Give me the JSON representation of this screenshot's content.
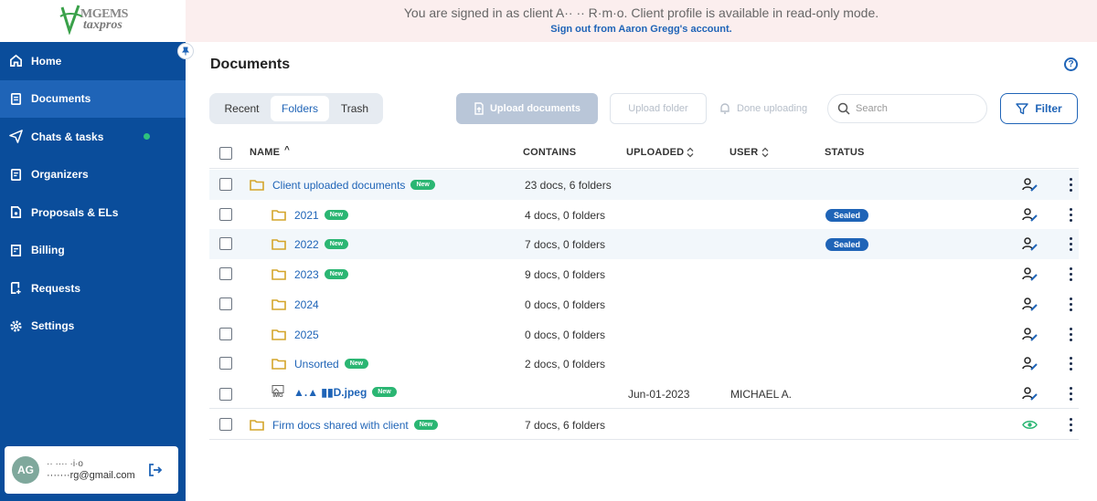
{
  "logo": {
    "line1": "MGEMS",
    "line2": "taxpros"
  },
  "banner": {
    "line1": "You are signed in as client A·· ·· R·m·o. Client profile is available in read-only mode.",
    "line2": "Sign out from Aaron Gregg's account."
  },
  "sidebar": {
    "items": [
      {
        "label": "Home",
        "icon": "home-icon"
      },
      {
        "label": "Documents",
        "icon": "document-icon"
      },
      {
        "label": "Chats & tasks",
        "icon": "send-icon"
      },
      {
        "label": "Organizers",
        "icon": "clipboard-icon"
      },
      {
        "label": "Proposals & ELs",
        "icon": "file-icon"
      },
      {
        "label": "Billing",
        "icon": "invoice-icon"
      },
      {
        "label": "Requests",
        "icon": "request-icon"
      },
      {
        "label": "Settings",
        "icon": "gear-icon"
      }
    ]
  },
  "user": {
    "initials": "AG",
    "name": "·· ···· ·i·o",
    "email": "·······rg@gmail.com"
  },
  "page": {
    "title": "Documents"
  },
  "tabs": [
    "Recent",
    "Folders",
    "Trash"
  ],
  "toolbar": {
    "upload": "Upload documents",
    "upload_folder": "Upload folder",
    "done": "Done uploading",
    "search_placeholder": "Search",
    "filter": "Filter"
  },
  "table": {
    "headers": {
      "name": "NAME",
      "sort": "^",
      "contains": "CONTAINS",
      "uploaded": "UPLOADED",
      "user": "USER",
      "status": "STATUS"
    },
    "new_label": "New",
    "sealed_label": "Sealed",
    "rows": [
      {
        "name": "Client uploaded documents",
        "contains": "23 docs, 6 folders",
        "uploaded": "",
        "user": "",
        "status": ""
      },
      {
        "name": "2021",
        "contains": "4 docs, 0 folders",
        "uploaded": "",
        "user": "",
        "status": "Sealed"
      },
      {
        "name": "2022",
        "contains": "7 docs, 0 folders",
        "uploaded": "",
        "user": "",
        "status": "Sealed"
      },
      {
        "name": "2023",
        "contains": "9 docs, 0 folders",
        "uploaded": "",
        "user": "",
        "status": ""
      },
      {
        "name": "2024",
        "contains": "0 docs, 0 folders",
        "uploaded": "",
        "user": "",
        "status": ""
      },
      {
        "name": "2025",
        "contains": "0 docs, 0 folders",
        "uploaded": "",
        "user": "",
        "status": ""
      },
      {
        "name": "Unsorted",
        "contains": "2 docs, 0 folders",
        "uploaded": "",
        "user": "",
        "status": ""
      },
      {
        "name": "▲.▲  ▮▮D.jpeg",
        "file_tag": "IMG",
        "contains": "",
        "uploaded": "Jun-01-2023",
        "user": "MICHAEL A.",
        "status": ""
      },
      {
        "name": "Firm docs shared with client",
        "contains": "7 docs, 6 folders",
        "uploaded": "",
        "user": "",
        "status": ""
      }
    ]
  },
  "colors": {
    "sidebar": "#0a4d9b",
    "sidebar_active": "#1f64b7",
    "accent": "#1f64b7",
    "new_badge": "#2bb673",
    "banner": "#fbeeee",
    "folder": "#d4a52a"
  }
}
